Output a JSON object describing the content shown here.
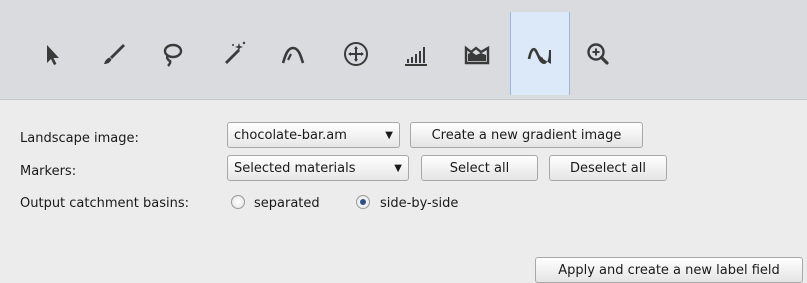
{
  "toolbar": {
    "tools": [
      {
        "icon": "pointer-arrow-icon"
      },
      {
        "icon": "brush-icon"
      },
      {
        "icon": "lasso-icon"
      },
      {
        "icon": "magic-wand-icon"
      },
      {
        "icon": "propagating-contour-icon"
      },
      {
        "icon": "blow-tool-icon"
      },
      {
        "icon": "threshold-histogram-icon"
      },
      {
        "icon": "top-hat-icon"
      },
      {
        "icon": "watershed-icon",
        "active": true
      },
      {
        "icon": "zoom-in-icon"
      }
    ]
  },
  "form": {
    "landscape_label": "Landscape image:",
    "landscape_value": "chocolate-bar.am",
    "create_gradient_label": "Create a new gradient image",
    "markers_label": "Markers:",
    "markers_value": "Selected materials",
    "select_all_label": "Select all",
    "deselect_all_label": "Deselect all",
    "output_label": "Output catchment basins:",
    "radio_options": [
      {
        "label": "separated",
        "selected": false
      },
      {
        "label": "side-by-side",
        "selected": true
      }
    ],
    "apply_label": "Apply and create a new label field"
  },
  "colors": {
    "toolbar_bg": "#d9dbdf",
    "active_tool_bg": "#dce9f8",
    "icon_color": "#3a3a3a"
  }
}
